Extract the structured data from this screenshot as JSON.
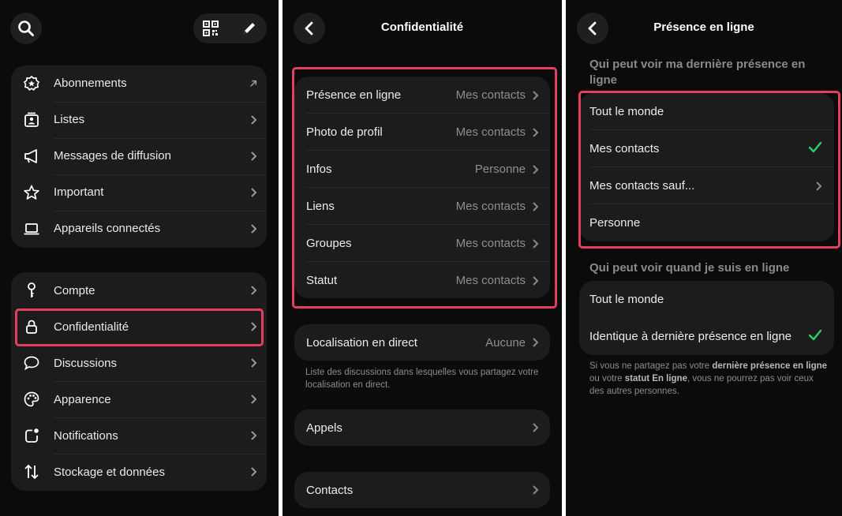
{
  "panel1": {
    "top_icons": [
      "search-icon",
      "qr-code-icon",
      "edit-pencil-icon"
    ],
    "group1": [
      {
        "label": "Abonnements",
        "icon": "subscriptions-badge-icon",
        "trail": "arrow-up-right-icon"
      },
      {
        "label": "Listes",
        "icon": "lists-icon",
        "trail": "chevron-right-icon"
      },
      {
        "label": "Messages de diffusion",
        "icon": "megaphone-icon",
        "trail": "chevron-right-icon"
      },
      {
        "label": "Important",
        "icon": "star-icon",
        "trail": "chevron-right-icon"
      },
      {
        "label": "Appareils connectés",
        "icon": "laptop-icon",
        "trail": "chevron-right-icon"
      }
    ],
    "group2": [
      {
        "label": "Compte",
        "icon": "key-icon"
      },
      {
        "label": "Confidentialité",
        "icon": "lock-icon"
      },
      {
        "label": "Discussions",
        "icon": "chat-bubble-icon"
      },
      {
        "label": "Apparence",
        "icon": "palette-icon"
      },
      {
        "label": "Notifications",
        "icon": "notification-icon"
      },
      {
        "label": "Stockage et données",
        "icon": "storage-arrows-icon"
      }
    ],
    "highlighted": "Confidentialité",
    "highlight_color": "#e2405e"
  },
  "panel2": {
    "title": "Confidentialité",
    "privacy_rows": [
      {
        "label": "Présence en ligne",
        "value": "Mes contacts"
      },
      {
        "label": "Photo de profil",
        "value": "Mes contacts"
      },
      {
        "label": "Infos",
        "value": "Personne"
      },
      {
        "label": "Liens",
        "value": "Mes contacts"
      },
      {
        "label": "Groupes",
        "value": "Mes contacts"
      },
      {
        "label": "Statut",
        "value": "Mes contacts"
      }
    ],
    "live_location": {
      "label": "Localisation en direct",
      "value": "Aucune"
    },
    "live_location_note": "Liste des discussions dans lesquelles vous partagez votre localisation en direct.",
    "calls": "Appels",
    "contacts": "Contacts"
  },
  "panel3": {
    "title": "Présence en ligne",
    "section1_title": "Qui peut voir ma dernière présence en ligne",
    "section1_options": [
      "Tout le monde",
      "Mes contacts",
      "Mes contacts sauf...",
      "Personne"
    ],
    "section1_selected": "Mes contacts",
    "section2_title": "Qui peut voir quand je suis en ligne",
    "section2_options": [
      "Tout le monde",
      "Identique à dernière présence en ligne"
    ],
    "section2_selected": "Identique à dernière présence en ligne",
    "note": {
      "p1": "Si vous ne partagez pas votre ",
      "b1": "dernière présence en ligne",
      "p2": " ou votre ",
      "b2": "statut En ligne",
      "p3": ", vous ne pourrez pas voir ceux des autres personnes."
    },
    "check_color": "#25d366"
  }
}
